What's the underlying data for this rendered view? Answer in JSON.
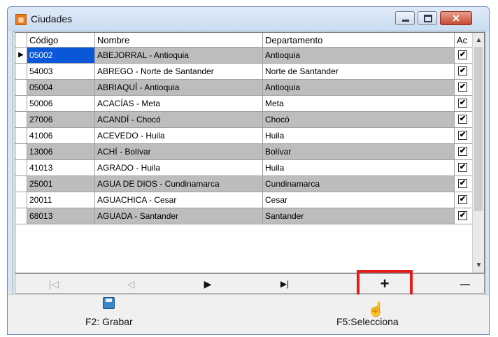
{
  "window": {
    "title": "Ciudades"
  },
  "grid": {
    "columns": [
      "Código",
      "Nombre",
      "Departamento",
      "Ac"
    ],
    "rows": [
      {
        "codigo": "05002",
        "nombre": "ABEJORRAL - Antioquia",
        "departamento": "Antioquia",
        "activo": "✔"
      },
      {
        "codigo": "54003",
        "nombre": "ABREGO - Norte de Santander",
        "departamento": "Norte de Santander",
        "activo": "✔"
      },
      {
        "codigo": "05004",
        "nombre": "ABRIAQUÍ - Antioquia",
        "departamento": "Antioquia",
        "activo": "✔"
      },
      {
        "codigo": "50006",
        "nombre": "ACACÍAS - Meta",
        "departamento": "Meta",
        "activo": "✔"
      },
      {
        "codigo": "27006",
        "nombre": "ACANDÍ - Chocó",
        "departamento": "Chocó",
        "activo": "✔"
      },
      {
        "codigo": "41006",
        "nombre": "ACEVEDO - Huila",
        "departamento": "Huila",
        "activo": "✔"
      },
      {
        "codigo": "13006",
        "nombre": "ACHÍ - Bolívar",
        "departamento": "Bolívar",
        "activo": "✔"
      },
      {
        "codigo": "41013",
        "nombre": "AGRADO - Huila",
        "departamento": "Huila",
        "activo": "✔"
      },
      {
        "codigo": "25001",
        "nombre": "AGUA DE DIOS - Cundinamarca",
        "departamento": "Cundinamarca",
        "activo": "✔"
      },
      {
        "codigo": "20011",
        "nombre": "AGUACHICA - Cesar",
        "departamento": "Cesar",
        "activo": "✔"
      },
      {
        "codigo": "68013",
        "nombre": "AGUADA - Santander",
        "departamento": "Santander",
        "activo": "✔"
      }
    ],
    "current_row_marker": "▶"
  },
  "navigator": {
    "first": "|◁",
    "prior": "◁",
    "next": "▶",
    "last": "▶|",
    "insert": "+",
    "delete": "—"
  },
  "footer": {
    "save_label": "F2: Grabar",
    "select_label": "F5:Selecciona"
  },
  "icons": {
    "app": "city-app-icon",
    "save": "floppy-disk-icon",
    "cursor": "hand-pointer-icon"
  },
  "colors": {
    "selected_cell": "#0a57d8",
    "alt_row": "#bdbdbd",
    "highlight_box": "#e21d1d"
  }
}
